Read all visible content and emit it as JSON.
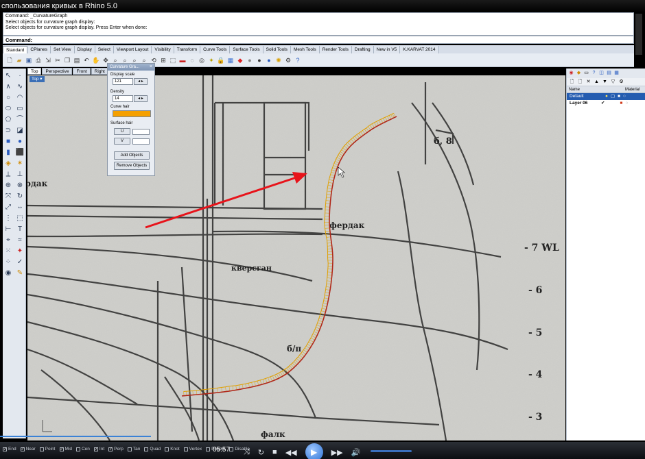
{
  "video": {
    "title": "спользования кривых в Rhino 5.0",
    "time": "05:57"
  },
  "command": {
    "history": [
      "Command: _CurvatureGraph",
      "Select objects for curvature graph display:",
      "Select objects for curvature graph display. Press Enter when done:"
    ],
    "prompt": "Command:"
  },
  "tabs": [
    "Standard",
    "CPlanes",
    "Set View",
    "Display",
    "Select",
    "Viewport Layout",
    "Visibility",
    "Transform",
    "Curve Tools",
    "Surface Tools",
    "Solid Tools",
    "Mesh Tools",
    "Render Tools",
    "Drafting",
    "New in V5",
    "K.KARVAT 2014"
  ],
  "viewport_tabs": [
    "Top",
    "Perspective",
    "Front",
    "Right"
  ],
  "viewport_label": "Top",
  "curvature_panel": {
    "title": "Curvature Gra...",
    "display_scale_label": "Display scale",
    "display_scale": "121",
    "density_label": "Density",
    "density": "14",
    "curve_hair_label": "Curve hair",
    "curve_hair_color": "#f5a000",
    "surface_hair_label": "Surface hair",
    "u_label": "U",
    "v_label": "V",
    "add_button": "Add Objects",
    "remove_button": "Remove Objects"
  },
  "drawing_labels": {
    "ferdak_left": "фердак",
    "ferdak_mid": "фердак",
    "kverstam": "кверсган",
    "bp": "б/п",
    "falk": "фалк",
    "wl7": "- 7 WL",
    "wl6": "- 6",
    "wl5": "- 5",
    "wl4": "- 4",
    "wl3": "- 3",
    "b8": "б, 8"
  },
  "layers": {
    "header": [
      "Name",
      "Material"
    ],
    "rows": [
      {
        "name": "Default",
        "selected": true
      },
      {
        "name": "Layer 06",
        "selected": false
      }
    ]
  },
  "osnaps": [
    {
      "label": "End",
      "checked": true
    },
    {
      "label": "Near",
      "checked": true
    },
    {
      "label": "Point",
      "checked": false
    },
    {
      "label": "Mid",
      "checked": true
    },
    {
      "label": "Cen",
      "checked": false
    },
    {
      "label": "Int",
      "checked": true
    },
    {
      "label": "Perp",
      "checked": true
    },
    {
      "label": "Tan",
      "checked": false
    },
    {
      "label": "Quad",
      "checked": false
    },
    {
      "label": "Knot",
      "checked": false
    },
    {
      "label": "Vertex",
      "checked": false
    },
    {
      "label": "Project",
      "checked": false
    },
    {
      "label": "Disable",
      "checked": false
    }
  ],
  "colors": {
    "accent": "#3b82d6",
    "arrow": "#e8131a",
    "graph": "#e0a000",
    "curve": "#b0281a"
  }
}
